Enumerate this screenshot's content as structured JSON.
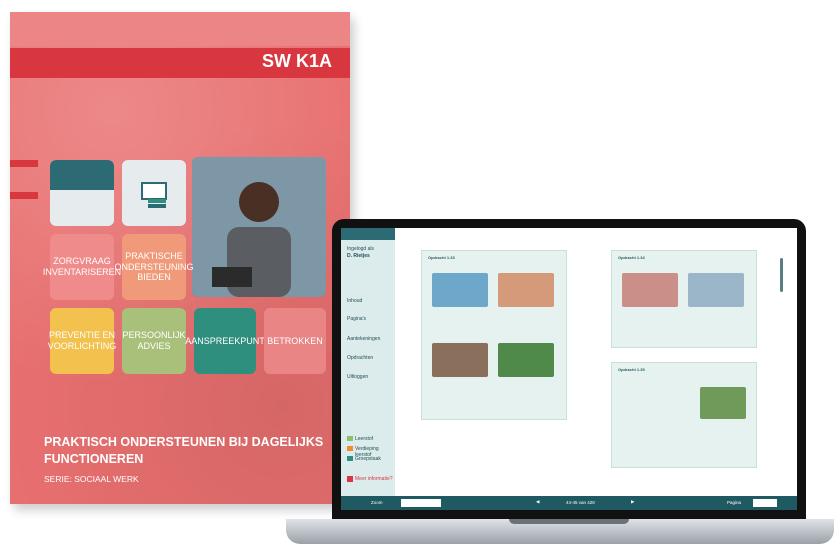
{
  "book": {
    "code": "SW K1A",
    "title_line1": "PRAKTISCH ONDERSTEUNEN BIJ DAGELIJKS",
    "title_line2": "FUNCTIONEREN",
    "series": "SERIE: SOCIAAL WERK",
    "tiles": [
      {
        "label": "ZORGVRAAG INVENTARISEREN",
        "color": "#f08b8b"
      },
      {
        "label": "PRAKTISCHE ONDERSTEUNING BIEDEN",
        "color": "#f09a7a"
      },
      {
        "label": "PREVENTIE EN VOORLICHTING",
        "color": "#f2c14e"
      },
      {
        "label": "PERSOONLIJK ADVIES",
        "color": "#a9c07a"
      },
      {
        "label": "AANSPREEKPUNT",
        "color": "#2f8f7e"
      },
      {
        "label": "BETROKKEN",
        "color": "#e98585"
      }
    ]
  },
  "screen": {
    "logged_in_as": "Ingelogd als",
    "user": "D. Rietjes",
    "nav": [
      "Inhoud",
      "Pagina's",
      "Aantekeningen",
      "Opdrachten",
      "Uitloggen"
    ],
    "legend": [
      "Leerstof",
      "Verdieping leerstof",
      "Groepstaak"
    ],
    "footer_link": "Meer informatie?",
    "left_box_title": "Opdracht 1.33",
    "right_box_title": "Opdracht 1.34",
    "right_box2_title": "Opdracht 1.35",
    "toolbar": {
      "zoom": "Zoom",
      "pages": "44-45 van 428",
      "page": "Pagina"
    }
  }
}
